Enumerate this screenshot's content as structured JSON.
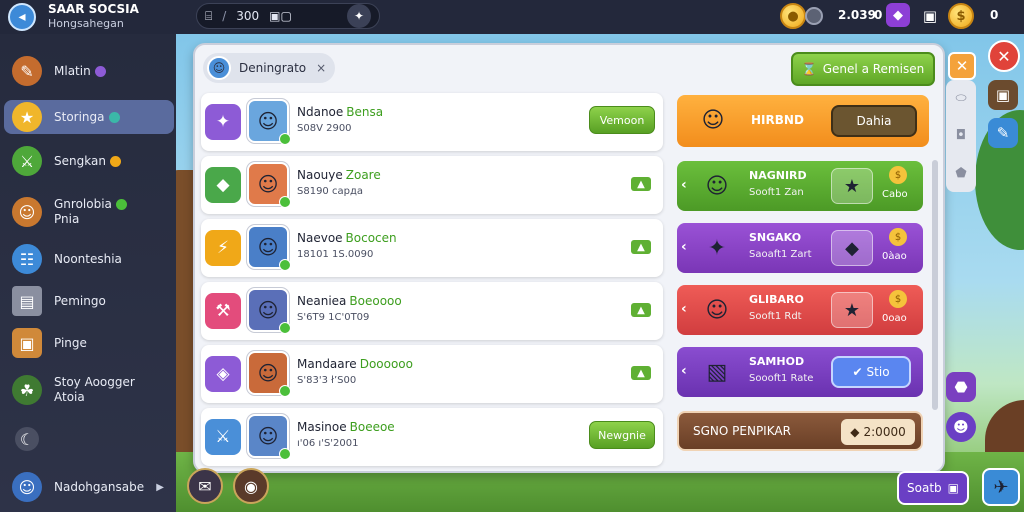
{
  "app": {
    "title": "SAAR SOCSIA",
    "subtitle": "Hongsahegan"
  },
  "topbar": {
    "pill_left": "Ⅱ\u0005",
    "pill_sep": "/",
    "pill_value": "300",
    "pill_mid": "▣▢",
    "coins": "2.039",
    "coin_alt": "0",
    "gold": "0"
  },
  "sidebar": {
    "items": [
      {
        "label": "Mlatin",
        "icon": "feather-icon",
        "glyph": "✎",
        "color": "#c46c2e",
        "dot": "#8d5bd6"
      },
      {
        "label": "Storinga",
        "icon": "star-icon",
        "glyph": "★",
        "color": "#f0b62b",
        "dot": "#3bb7a8",
        "active": true
      },
      {
        "label": "Sengkan",
        "icon": "sword-icon",
        "glyph": "⚔",
        "color": "#4ea83a",
        "dot": "#f0a818"
      },
      {
        "label": "Gnrolobia",
        "label2": "Pnia",
        "icon": "hero-icon",
        "glyph": "☺",
        "color": "#c9782f",
        "dot": "#4bbf3a"
      },
      {
        "label": "Noonteshia",
        "icon": "card-icon",
        "glyph": "☷",
        "color": "#3d8ad8"
      },
      {
        "label": "Pemingo",
        "icon": "chest-icon",
        "glyph": "▤",
        "color": "#8a8fa0"
      },
      {
        "label": "Pinge",
        "icon": "treasure-icon",
        "glyph": "▣",
        "color": "#d0893a"
      },
      {
        "label": "Stoy Aoogger",
        "label2": "Atoia",
        "icon": "clan-icon",
        "glyph": "☘",
        "color": "#3f7a32"
      },
      {
        "label": "",
        "icon": "moon-icon",
        "glyph": "☾",
        "color": "#4a4f62"
      },
      {
        "label": "Nadohgansabe",
        "icon": "profile-icon",
        "glyph": "☺",
        "color": "#3a6fc0",
        "arrow": "▶"
      }
    ]
  },
  "panel": {
    "search_chip": "Deningrato",
    "chip_close": "×",
    "header_button": "Genel a Remisen",
    "rows": [
      {
        "icon_color": "#8d5bd6",
        "glyph": "✦",
        "name": "Ndanoe",
        "highlight": "Bensa",
        "sub": "S08V 2900",
        "button": "Vemoon"
      },
      {
        "icon_color": "#4aa84a",
        "glyph": "◆",
        "name": "Naouye",
        "highlight": "Zoare",
        "sub": "S8190 сарда",
        "mini": "▲"
      },
      {
        "icon_color": "#f0a818",
        "glyph": "⚡",
        "name": "Naevoe",
        "highlight": "Bococen",
        "sub": "18101 1S.0090",
        "mini": "▲"
      },
      {
        "icon_color": "#e34c7c",
        "glyph": "⚒",
        "name": "Neaniea",
        "highlight": "Boeoooo",
        "sub": "S'6T9 1C'0T09",
        "mini": "▲"
      },
      {
        "icon_color": "#8d5bd6",
        "glyph": "◈",
        "name": "Mandaare",
        "highlight": "Doooooo",
        "sub": "S'83'3 ł’S00",
        "mini": "▲"
      },
      {
        "icon_color": "#4a8fd8",
        "glyph": "⚔",
        "name": "Masinoe",
        "highlight": "Boeeoe",
        "sub": "ı'06 ı'S'2001",
        "button": "Newgnie"
      }
    ],
    "rewards": [
      {
        "style": "orange",
        "title": "HIRBND",
        "cta": "Dahia",
        "glyph": "☺"
      },
      {
        "style": "green",
        "title": "NAGNIRD",
        "sub": "Sooft1 Zan",
        "glyph": "☺",
        "box": "★",
        "cost": "Cabo"
      },
      {
        "style": "purple",
        "title": "SNGAKO",
        "sub": "Saoaft1 Zart",
        "glyph": "✦",
        "box": "◆",
        "cost": "0àao"
      },
      {
        "style": "red",
        "title": "GLIBARO",
        "sub": "Sooft1 Rdt",
        "glyph": "☺",
        "box": "★",
        "cost": "0oao"
      },
      {
        "style": "violet",
        "title": "SAMHOD",
        "sub": "Soooft1 Rate",
        "glyph": "▧",
        "cta": "Stio"
      },
      {
        "style": "brown",
        "title": "SGNO PENPIKAR",
        "price": "2:0000"
      }
    ]
  },
  "bottom": {
    "button": "Soatb"
  }
}
